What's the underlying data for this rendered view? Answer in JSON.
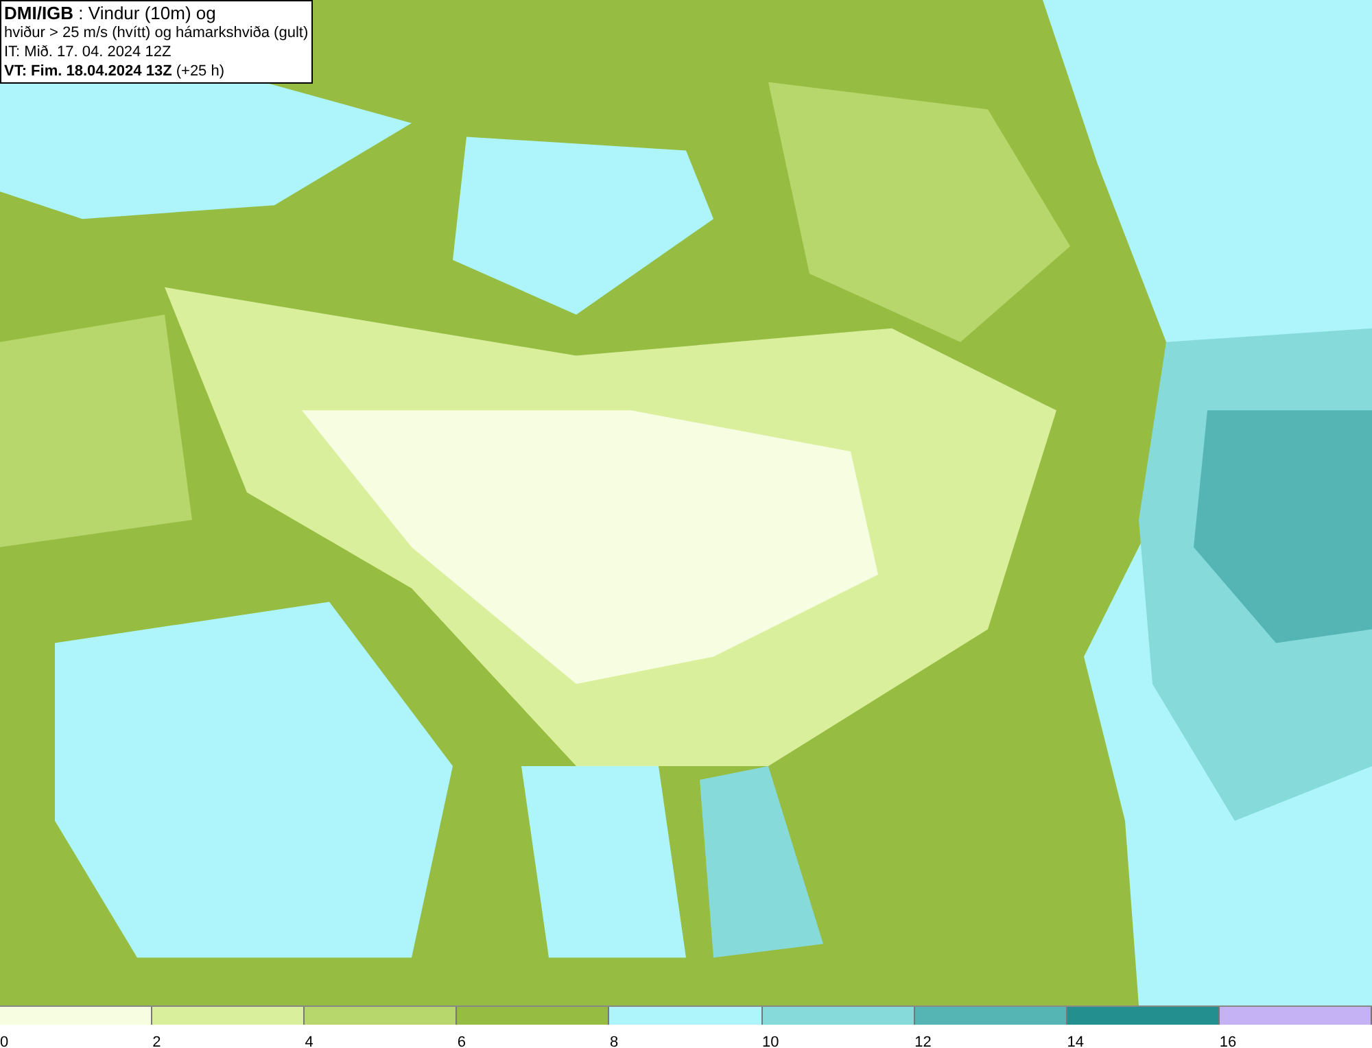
{
  "info_box": {
    "lines": [
      "**DMI/IGB** : Vindur (10m) og",
      "hviður > 25 m/s (hvítt) og hámarkshviða (gult)",
      "IT: Mið. 17. 04. 2024 12Z",
      "**VT: Fim. 18.04.2024 13Z** (+25 h)"
    ]
  },
  "color_scale": {
    "segments": [
      {
        "color": "#f7fde0"
      },
      {
        "color": "#d9ef9c"
      },
      {
        "color": "#b7d76c"
      },
      {
        "color": "#96bd42"
      },
      {
        "color": "#adf5fb"
      },
      {
        "color": "#86dada"
      },
      {
        "color": "#55b5b5"
      },
      {
        "color": "#238f8e"
      },
      {
        "color": "#c4b2f5"
      }
    ],
    "ticks": [
      "0",
      "2",
      "4",
      "6",
      "8",
      "10",
      "12",
      "14",
      "16"
    ]
  }
}
